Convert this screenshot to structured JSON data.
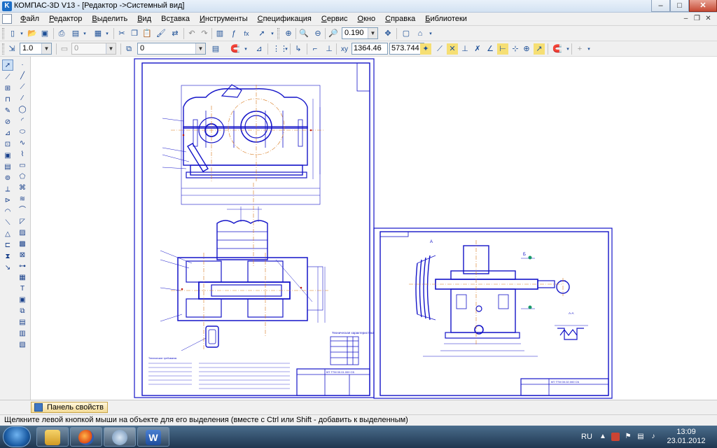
{
  "window": {
    "title": "КОМПАС-3D V13 - [Редактор ->Системный вид]",
    "app_icon": "kompas-app-icon"
  },
  "menu": {
    "items": [
      "Файл",
      "Редактор",
      "Выделить",
      "Вид",
      "Вставка",
      "Инструменты",
      "Спецификация",
      "Сервис",
      "Окно",
      "Справка",
      "Библиотеки"
    ],
    "underline": [
      "Ф",
      "Р",
      "В",
      "В",
      "т",
      "И",
      "С",
      "С",
      "О",
      "С",
      "Б"
    ]
  },
  "toolbar1": {
    "zoom_value": "0.190"
  },
  "toolbar2": {
    "line_scale": "1.0",
    "style_value": "0",
    "layer_value": "0",
    "coord_x": "1364.46",
    "coord_y": "573.744"
  },
  "panel": {
    "tab_label": "Панель свойств"
  },
  "status": {
    "hint": "Щелкните левой кнопкой мыши на объекте для его выделения (вместе с Ctrl или Shift - добавить к выделенным)"
  },
  "taskbar": {
    "language": "RU",
    "time": "13:09",
    "date": "23.01.2012",
    "apps": [
      "windows-explorer",
      "firefox",
      "kompas",
      "word"
    ]
  },
  "drawing": {
    "sheet1_caption_1": "Техническая характеристика",
    "sheet1_caption_2": "Технические требования",
    "sheet1_stamp": "КП ТТМ 00.01.000 СБ",
    "sheet2_stamp": "КП ТТМ 00.02.000 СБ",
    "sheet2_label_a": "А",
    "sheet2_label_b": "Б",
    "sheet2_view": "А-А"
  },
  "colors": {
    "drawing_line": "#1414c8",
    "center_line": "#d87a1e",
    "accent_red": "#c21d12"
  }
}
